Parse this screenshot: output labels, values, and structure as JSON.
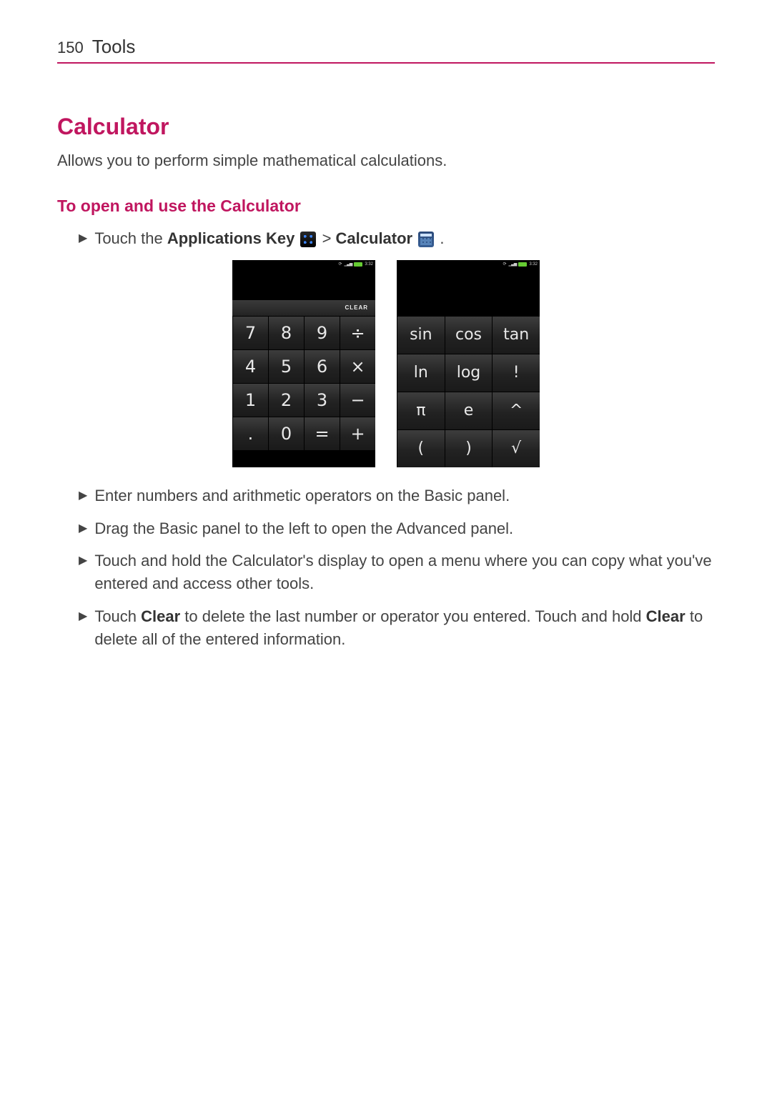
{
  "header": {
    "page_number": "150",
    "section": "Tools"
  },
  "title": "Calculator",
  "intro": "Allows you to perform simple mathematical calculations.",
  "subhead": "To open and use the Calculator",
  "step_open": {
    "prefix": "Touch the ",
    "apps_key_label": "Applications Key",
    "separator": " > ",
    "calc_label": "Calculator",
    "suffix": "."
  },
  "statusbar_time": "3:32",
  "clear_label": "CLEAR",
  "basic_keys": [
    "7",
    "8",
    "9",
    "÷",
    "4",
    "5",
    "6",
    "×",
    "1",
    "2",
    "3",
    "−",
    ".",
    "0",
    "=",
    "+"
  ],
  "adv_keys": [
    "sin",
    "cos",
    "tan",
    "ln",
    "log",
    "!",
    "π",
    "e",
    "^",
    "(",
    ")",
    "√"
  ],
  "bullets": [
    {
      "text": "Enter numbers and arithmetic operators on the Basic panel."
    },
    {
      "text": "Drag the Basic panel to the left to open the Advanced panel."
    },
    {
      "text": "Touch and hold the Calculator's display to open a menu where you can copy what you've entered and access other tools."
    },
    {
      "pre": "Touch ",
      "b1": "Clear",
      "mid": " to delete the last number or operator you entered. Touch and hold ",
      "b2": "Clear",
      "post": " to delete all of the entered information."
    }
  ]
}
